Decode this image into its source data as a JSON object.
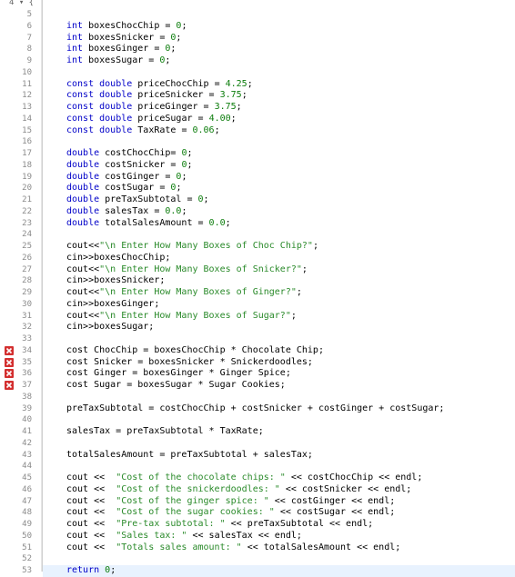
{
  "editor": {
    "top_partial": "4 ▾ {",
    "error_icon": "error-x-icon",
    "lines": [
      {
        "n": "5",
        "t": ""
      },
      {
        "n": "6",
        "t": "int boxesChocChip = 0;"
      },
      {
        "n": "7",
        "t": "int boxesSnicker = 0;"
      },
      {
        "n": "8",
        "t": "int boxesGinger = 0;"
      },
      {
        "n": "9",
        "t": "int boxesSugar = 0;"
      },
      {
        "n": "10",
        "t": ""
      },
      {
        "n": "11",
        "t": "const double priceChocChip = 4.25;"
      },
      {
        "n": "12",
        "t": "const double priceSnicker = 3.75;"
      },
      {
        "n": "13",
        "t": "const double priceGinger = 3.75;"
      },
      {
        "n": "14",
        "t": "const double priceSugar = 4.00;"
      },
      {
        "n": "15",
        "t": "const double TaxRate = 0.06;"
      },
      {
        "n": "16",
        "t": ""
      },
      {
        "n": "17",
        "t": "double costChocChip= 0;"
      },
      {
        "n": "18",
        "t": "double costSnicker = 0;"
      },
      {
        "n": "19",
        "t": "double costGinger = 0;"
      },
      {
        "n": "20",
        "t": "double costSugar = 0;"
      },
      {
        "n": "21",
        "t": "double preTaxSubtotal = 0;"
      },
      {
        "n": "22",
        "t": "double salesTax = 0.0;"
      },
      {
        "n": "23",
        "t": "double totalSalesAmount = 0.0;"
      },
      {
        "n": "24",
        "t": ""
      },
      {
        "n": "25",
        "t": "cout<<\"\\n Enter How Many Boxes of Choc Chip?\";"
      },
      {
        "n": "26",
        "t": "cin>>boxesChocChip;"
      },
      {
        "n": "27",
        "t": "cout<<\"\\n Enter How Many Boxes of Snicker?\";"
      },
      {
        "n": "28",
        "t": "cin>>boxesSnicker;"
      },
      {
        "n": "29",
        "t": "cout<<\"\\n Enter How Many Boxes of Ginger?\";"
      },
      {
        "n": "30",
        "t": "cin>>boxesGinger;"
      },
      {
        "n": "31",
        "t": "cout<<\"\\n Enter How Many Boxes of Sugar?\";"
      },
      {
        "n": "32",
        "t": "cin>>boxesSugar;"
      },
      {
        "n": "33",
        "t": ""
      },
      {
        "n": "34",
        "t": "cost ChocChip = boxesChocChip * Chocolate Chip;",
        "error": true
      },
      {
        "n": "35",
        "t": "cost Snicker = boxesSnicker * Snickerdoodles;",
        "error": true
      },
      {
        "n": "36",
        "t": "cost Ginger = boxesGinger * Ginger Spice;",
        "error": true
      },
      {
        "n": "37",
        "t": "cost Sugar = boxesSugar * Sugar Cookies;",
        "error": true
      },
      {
        "n": "38",
        "t": ""
      },
      {
        "n": "39",
        "t": "preTaxSubtotal = costChocChip + costSnicker + costGinger + costSugar;"
      },
      {
        "n": "40",
        "t": ""
      },
      {
        "n": "41",
        "t": "salesTax = preTaxSubtotal * TaxRate;"
      },
      {
        "n": "42",
        "t": ""
      },
      {
        "n": "43",
        "t": "totalSalesAmount = preTaxSubtotal + salesTax;"
      },
      {
        "n": "44",
        "t": ""
      },
      {
        "n": "45",
        "t": "cout <<  \"Cost of the chocolate chips: \" << costChocChip << endl;"
      },
      {
        "n": "46",
        "t": "cout <<  \"Cost of the snickerdoodles: \" << costSnicker << endl;"
      },
      {
        "n": "47",
        "t": "cout <<  \"Cost of the ginger spice: \" << costGinger << endl;"
      },
      {
        "n": "48",
        "t": "cout <<  \"Cost of the sugar cookies: \" << costSugar << endl;"
      },
      {
        "n": "49",
        "t": "cout <<  \"Pre-tax subtotal: \" << preTaxSubtotal << endl;"
      },
      {
        "n": "50",
        "t": "cout <<  \"Sales tax: \" << salesTax << endl;"
      },
      {
        "n": "51",
        "t": "cout <<  \"Totals sales amount: \" << totalSalesAmount << endl;"
      },
      {
        "n": "52",
        "t": ""
      },
      {
        "n": "53",
        "t": "return 0;",
        "current": true
      }
    ]
  }
}
